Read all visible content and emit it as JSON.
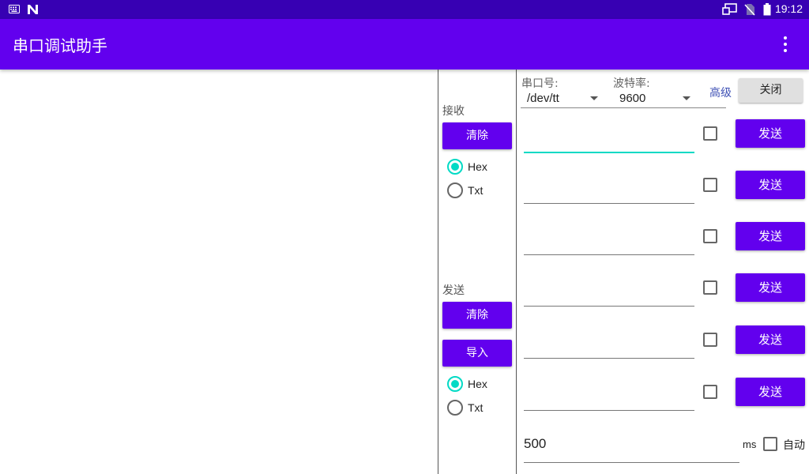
{
  "status_bar": {
    "time": "19:12",
    "left_icons": [
      "keyboard-icon",
      "n-notification-icon"
    ],
    "right_icons": [
      "cast-icon",
      "no-sim-icon",
      "battery-icon"
    ]
  },
  "app_bar": {
    "title": "串口调试助手",
    "menu_icon": "more-vert-icon"
  },
  "receive": {
    "label": "接收",
    "clear_label": "清除",
    "format_options": [
      {
        "label": "Hex",
        "selected": true
      },
      {
        "label": "Txt",
        "selected": false
      }
    ]
  },
  "send": {
    "label": "发送",
    "clear_label": "清除",
    "import_label": "导入",
    "format_options": [
      {
        "label": "Hex",
        "selected": true
      },
      {
        "label": "Txt",
        "selected": false
      }
    ]
  },
  "config": {
    "port_label": "串口号:",
    "port_value": "/dev/tt",
    "baud_label": "波特率:",
    "baud_value": "9600",
    "advanced_label": "高级",
    "close_label": "关闭"
  },
  "send_rows": [
    {
      "value": "",
      "checked": false,
      "button": "发送",
      "focused": true
    },
    {
      "value": "",
      "checked": false,
      "button": "发送",
      "focused": false
    },
    {
      "value": "",
      "checked": false,
      "button": "发送",
      "focused": false
    },
    {
      "value": "",
      "checked": false,
      "button": "发送",
      "focused": false
    },
    {
      "value": "",
      "checked": false,
      "button": "发送",
      "focused": false
    },
    {
      "value": "",
      "checked": false,
      "button": "发送",
      "focused": false
    }
  ],
  "auto_send": {
    "interval": "500",
    "unit": "ms",
    "label": "自动",
    "checked": false
  },
  "colors": {
    "status_bar": "#3700b3",
    "primary": "#6200ee",
    "accent": "#03dac5",
    "link": "#3f51b5"
  }
}
